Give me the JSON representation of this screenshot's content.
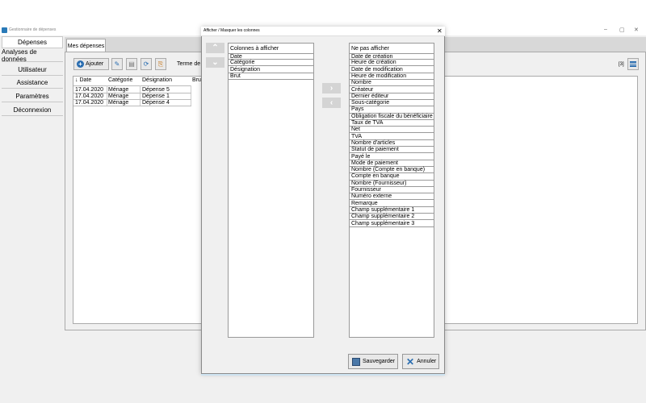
{
  "window": {
    "title": "Gestionnaire de dépenses",
    "minimize": "–",
    "maximize": "▢",
    "close": "✕"
  },
  "sidebar": {
    "items": [
      {
        "label": "Dépenses",
        "active": true
      },
      {
        "label": "Analyses de données"
      },
      {
        "label": "Utilisateur"
      },
      {
        "label": "Assistance"
      },
      {
        "label": "Paramètres"
      },
      {
        "label": "Déconnexion"
      }
    ]
  },
  "tabs": {
    "mes_depenses": "Mes dépenses"
  },
  "toolbar": {
    "add_label": "Ajouter",
    "add_icon": "+",
    "edit_icon": "✎",
    "delete_icon": "▤",
    "refresh_icon": "⟳",
    "copy_icon": "⎘",
    "terme_label": "Terme de",
    "count": "[3]"
  },
  "grid": {
    "headers": [
      "↓ Date",
      "Catégorie",
      "Désignation",
      "Bru"
    ],
    "rows": [
      [
        "17.04.2020",
        "Ménage",
        "Dépense 5"
      ],
      [
        "17.04.2020",
        "Ménage",
        "Dépense 1"
      ],
      [
        "17.04.2020",
        "Ménage",
        "Dépense 4"
      ]
    ]
  },
  "dialog": {
    "title": "Afficher / Masquer les colonnes",
    "close": "✕",
    "up_arrow": "⌃",
    "down_arrow": "⌄",
    "right_arrow": "›",
    "left_arrow": "‹",
    "shown_header": "Colonnes à afficher",
    "shown": [
      "Date",
      "Catégorie",
      "Désignation",
      "Brut"
    ],
    "hidden_header": "Ne pas afficher",
    "hidden": [
      "Date de création",
      "Heure de création",
      "Date de modification",
      "Heure de modification",
      "Nombre",
      "Créateur",
      "Dernier éditeur",
      "Sous-catégorie",
      "Pays",
      "Obligation fiscale du bénéficiaire",
      "Taux de TVA",
      "Net",
      "TVA",
      "Nombre d'articles",
      "Statut de paiement",
      "Payé le",
      "Mode de paiement",
      "Nombre (Compte en banque)",
      "Compte en banque",
      "Nombre (Fournisseur)",
      "Fournisseur",
      "Numéro externe",
      "Remarque",
      "Champ supplémentaire 1",
      "Champ supplémentaire 2",
      "Champ supplémentaire 3"
    ],
    "save_label": "Sauvegarder",
    "cancel_label": "Annuler"
  }
}
